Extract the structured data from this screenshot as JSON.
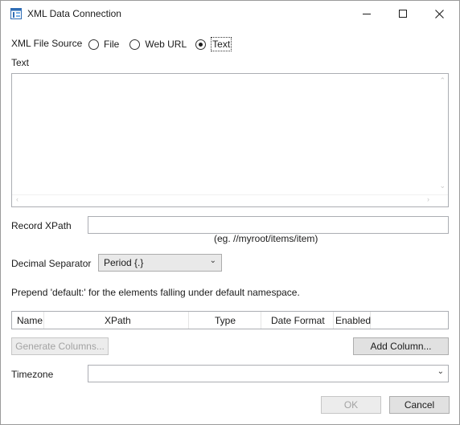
{
  "window": {
    "title": "XML Data Connection",
    "controls": [
      "minimize-icon",
      "maximize-icon",
      "close-icon"
    ]
  },
  "source": {
    "label": "XML File Source",
    "options": [
      {
        "label": "File",
        "selected": false
      },
      {
        "label": "Web URL",
        "selected": false
      },
      {
        "label": "Text",
        "selected": true
      }
    ]
  },
  "text_section": {
    "label": "Text",
    "value": ""
  },
  "record_xpath": {
    "label": "Record XPath",
    "value": "",
    "hint": "(eg. //myroot/items/item)"
  },
  "decimal_separator": {
    "label": "Decimal Separator",
    "value": "Period {.}"
  },
  "namespace_note": "Prepend 'default:' for the elements falling under default namespace.",
  "columns_table": {
    "headers": [
      "Name",
      "XPath",
      "Type",
      "Date Format",
      "Enabled"
    ],
    "rows": []
  },
  "buttons": {
    "generate_columns": "Generate Columns...",
    "add_column": "Add Column...",
    "ok": "OK",
    "cancel": "Cancel"
  },
  "timezone": {
    "label": "Timezone",
    "value": ""
  }
}
